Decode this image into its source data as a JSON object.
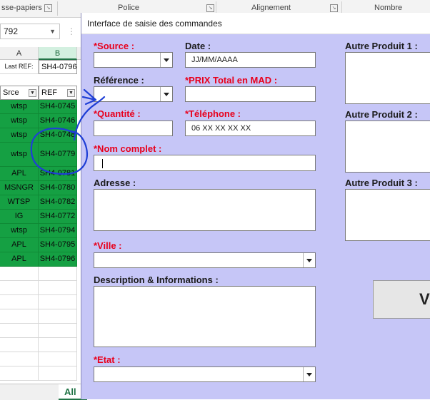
{
  "ribbon": {
    "groups": [
      {
        "label": "sse-papiers"
      },
      {
        "label": "Police"
      },
      {
        "label": "Alignement"
      },
      {
        "label": "Nombre"
      }
    ]
  },
  "namebox": {
    "value": "792"
  },
  "columns": [
    "A",
    "B"
  ],
  "last_ref": {
    "label": "Last REF:",
    "value": "SH4-0796"
  },
  "table": {
    "headers": [
      "Srce",
      "REF"
    ],
    "rows": [
      {
        "src": "wtsp",
        "ref": "SH4-0745"
      },
      {
        "src": "wtsp",
        "ref": "SH4-0746"
      },
      {
        "src": "wtsp",
        "ref": "SH4-0748"
      },
      {
        "src": "wtsp",
        "ref": "SH4-0779"
      },
      {
        "src": "APL",
        "ref": "SH4-0781"
      },
      {
        "src": "MSNGR",
        "ref": "SH4-0780"
      },
      {
        "src": "WTSP",
        "ref": "SH4-0782"
      },
      {
        "src": "IG",
        "ref": "SH4-0772"
      },
      {
        "src": "wtsp",
        "ref": "SH4-0794"
      },
      {
        "src": "APL",
        "ref": "SH4-0795"
      },
      {
        "src": "APL",
        "ref": "SH4-0796"
      }
    ]
  },
  "sheet_tab": {
    "label": "All"
  },
  "form": {
    "title": "Interface de saisie des commandes",
    "source_label": "*Source :",
    "date_label": "Date :",
    "date_value": "JJ/MM/AAAA",
    "reference_label": "Référence :",
    "prix_label": "*PRIX Total en MAD :",
    "quantite_label": "*Quantité :",
    "telephone_label": "*Téléphone :",
    "telephone_value": "06 XX XX XX XX",
    "nom_label": "*Nom complet :",
    "adresse_label": "Adresse :",
    "ville_label": "*Ville :",
    "description_label": "Description & Informations :",
    "etat_label": "*Etat :",
    "autre1_label": "Autre Produit 1 :",
    "autre2_label": "Autre Produit 2 :",
    "autre3_label": "Autre Produit 3 :",
    "button_label": "V"
  },
  "colors": {
    "form_bg": "#c6c6f7",
    "required_label": "#e8001c",
    "row_green": "#15a043",
    "annotation_blue": "#1f3fd6"
  }
}
